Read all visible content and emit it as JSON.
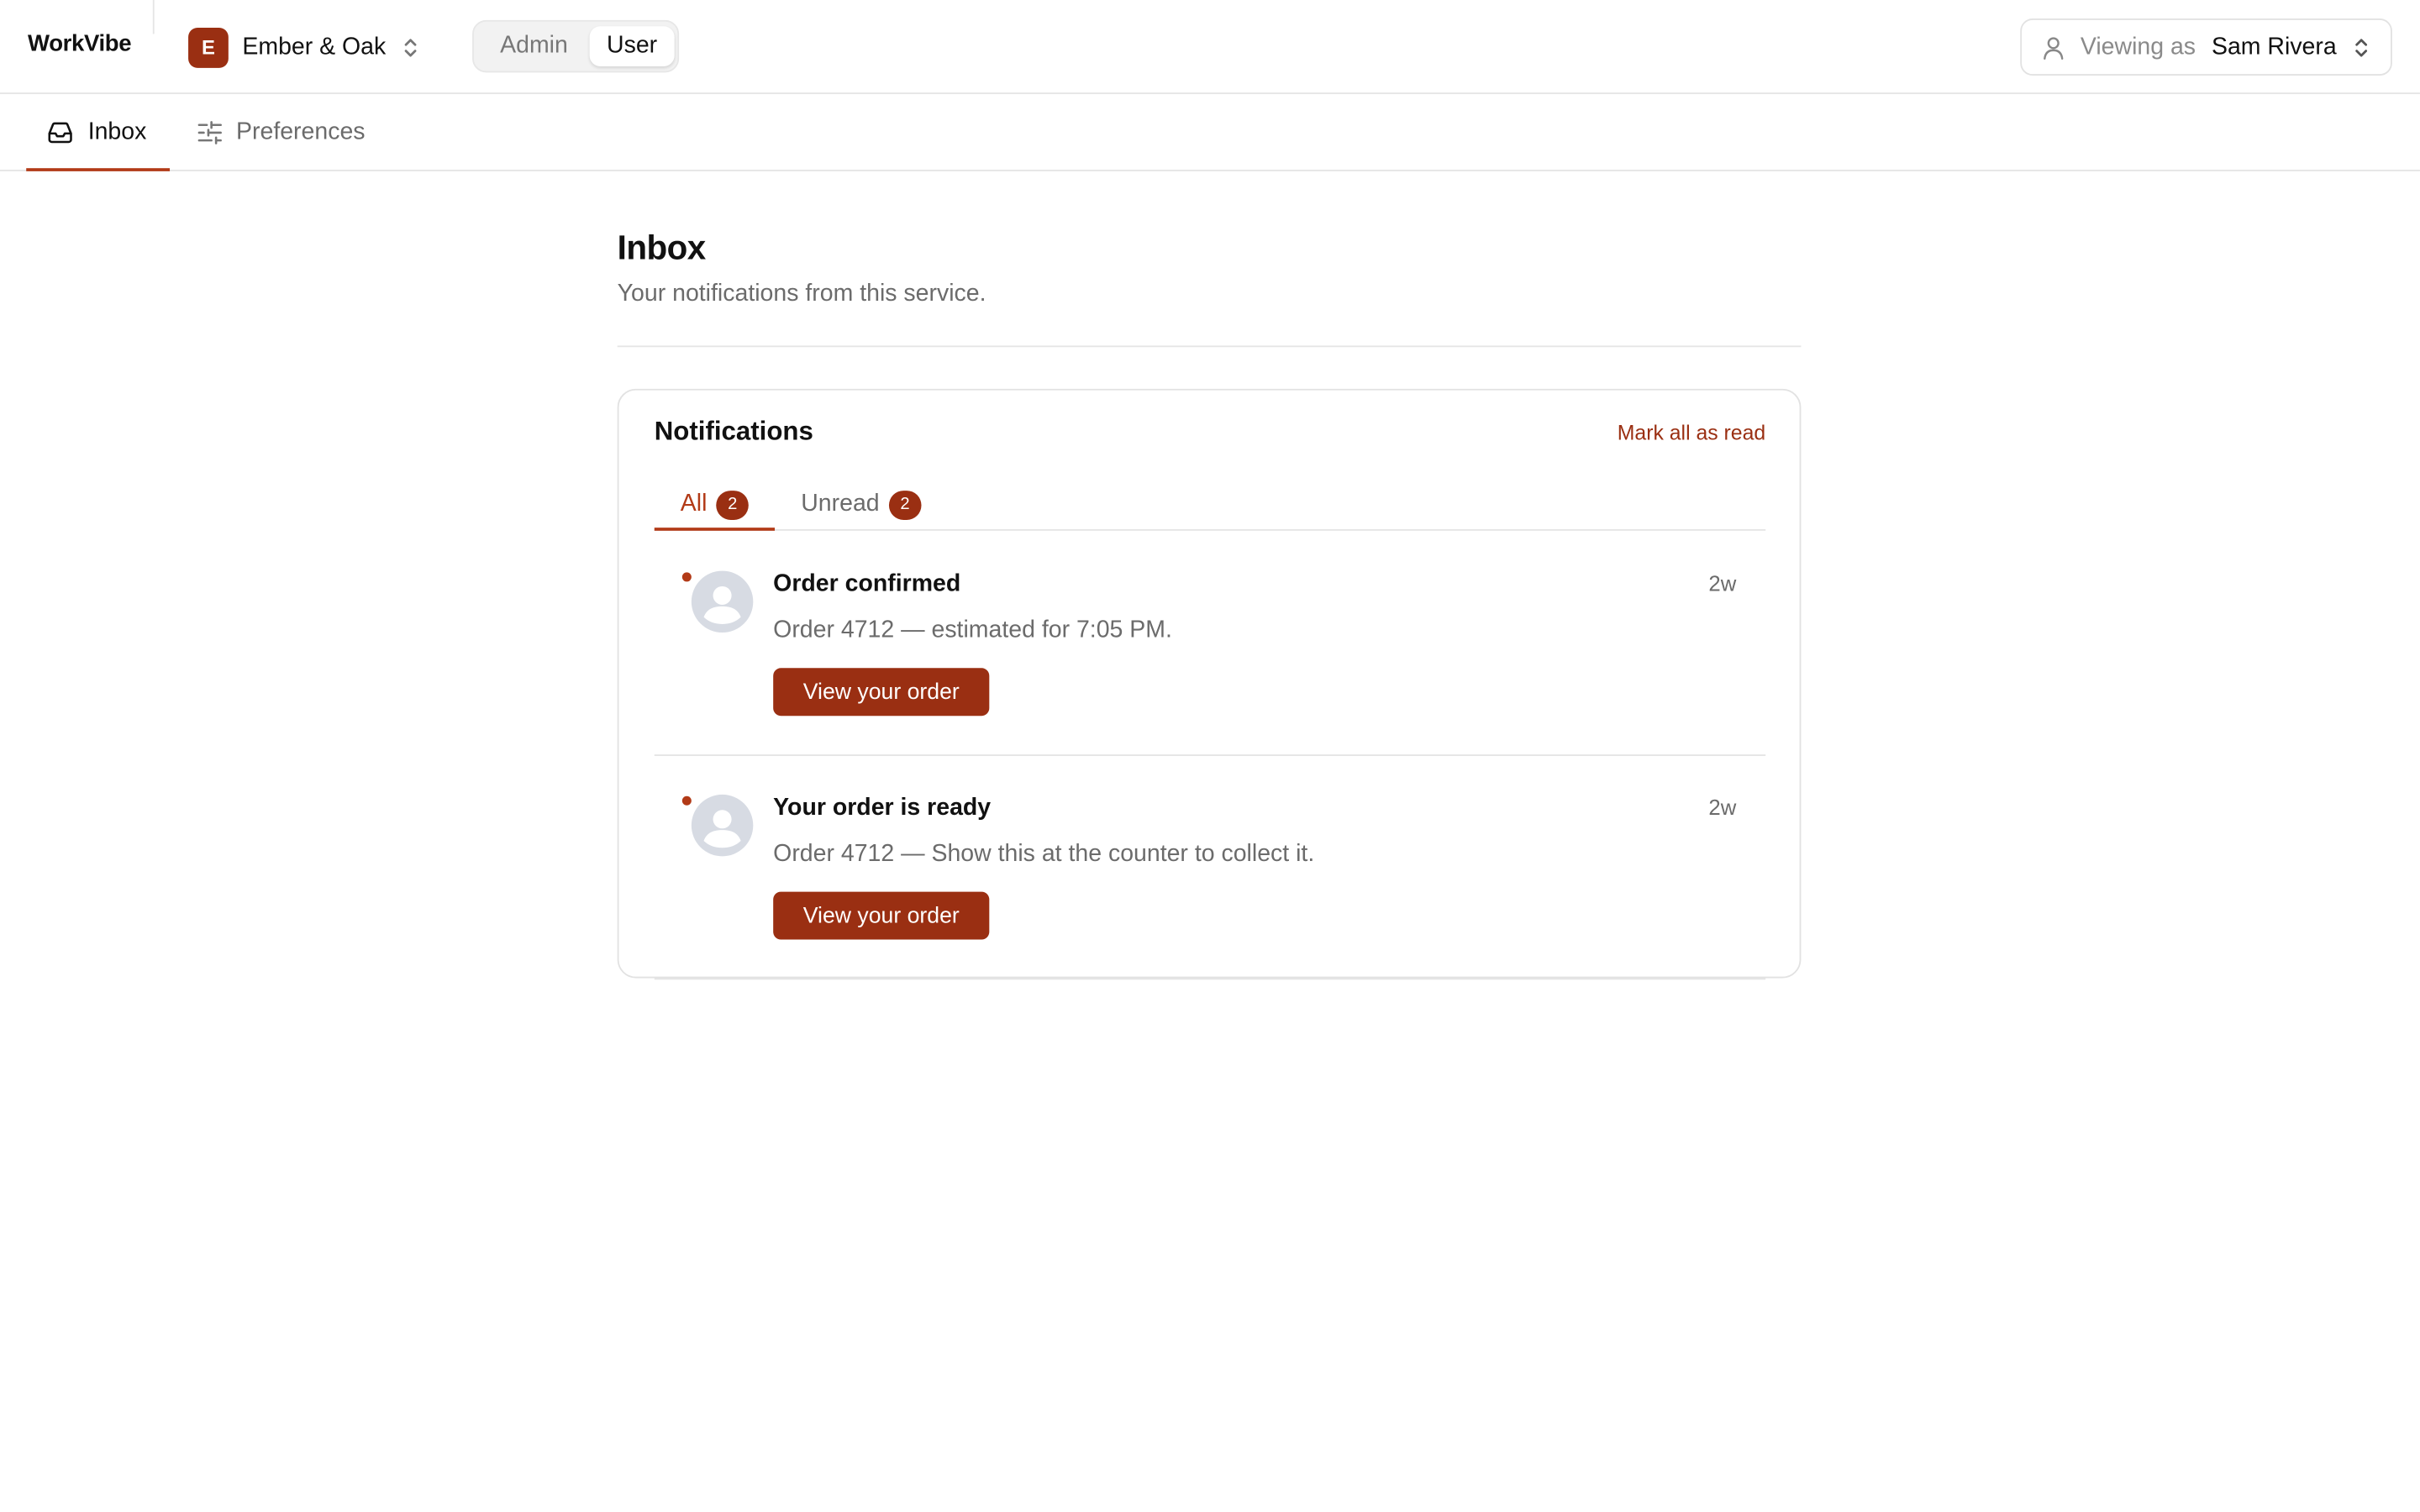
{
  "app": {
    "brand": "WorkVibe",
    "workspace": {
      "initial": "E",
      "name": "Ember & Oak"
    },
    "mode_toggle": {
      "options": [
        "Admin",
        "User"
      ],
      "selected": "User"
    },
    "viewing_as": {
      "label": "Viewing as",
      "user": "Sam Rivera"
    }
  },
  "nav": {
    "tabs": [
      {
        "label": "Inbox",
        "icon": "inbox-icon",
        "active": true
      },
      {
        "label": "Preferences",
        "icon": "sliders-icon",
        "active": false
      }
    ]
  },
  "page": {
    "title": "Inbox",
    "subtitle": "Your notifications from this service."
  },
  "notifications": {
    "title": "Notifications",
    "mark_all_label": "Mark all as read",
    "filters": [
      {
        "label": "All",
        "count": "2",
        "active": true
      },
      {
        "label": "Unread",
        "count": "2",
        "active": false
      }
    ],
    "items": [
      {
        "title": "Order confirmed",
        "body": "Order 4712 — estimated for 7:05 PM.",
        "time": "2w",
        "action": "View your order",
        "unread": true
      },
      {
        "title": "Your order is ready",
        "body": "Order 4712 — Show this at the counter to collect it.",
        "time": "2w",
        "action": "View your order",
        "unread": true
      }
    ]
  },
  "colors": {
    "accent": "#9a2f12",
    "accent_text": "#b23a17",
    "muted_text": "#6b6b6b",
    "border": "#e5e5e5",
    "avatar_placeholder": "#d7dbe3"
  }
}
